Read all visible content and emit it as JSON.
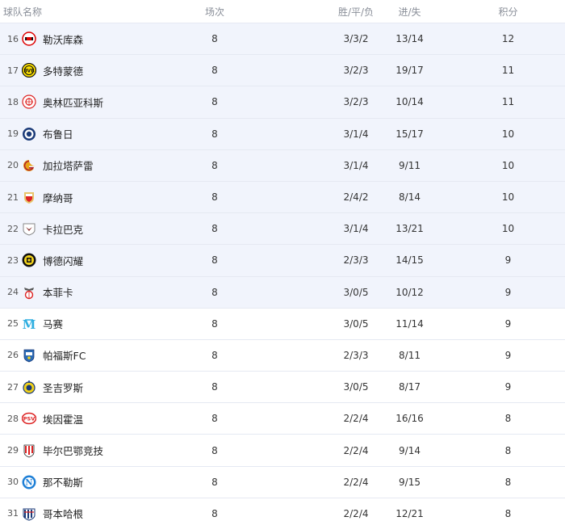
{
  "headers": {
    "team": "球队名称",
    "played": "场次",
    "wdl": "胜/平/负",
    "goals": "进/失",
    "points": "积分"
  },
  "colors": {
    "highlight_row": "#f1f4fc",
    "header_text": "#8a8f99",
    "divider": "#e5e9f2"
  },
  "rows": [
    {
      "rank": "16",
      "team": "勒沃库森",
      "played": "8",
      "wdl": "3/3/2",
      "goals": "13/14",
      "points": "12",
      "icon": "leverkusen-logo-icon",
      "highlight": true
    },
    {
      "rank": "17",
      "team": "多特蒙德",
      "played": "8",
      "wdl": "3/2/3",
      "goals": "19/17",
      "points": "11",
      "icon": "dortmund-logo-icon",
      "highlight": true
    },
    {
      "rank": "18",
      "team": "奥林匹亚科斯",
      "played": "8",
      "wdl": "3/2/3",
      "goals": "10/14",
      "points": "11",
      "icon": "olympiacos-logo-icon",
      "highlight": true
    },
    {
      "rank": "19",
      "team": "布鲁日",
      "played": "8",
      "wdl": "3/1/4",
      "goals": "15/17",
      "points": "10",
      "icon": "brugge-logo-icon",
      "highlight": true
    },
    {
      "rank": "20",
      "team": "加拉塔萨雷",
      "played": "8",
      "wdl": "3/1/4",
      "goals": "9/11",
      "points": "10",
      "icon": "galatasaray-logo-icon",
      "highlight": true
    },
    {
      "rank": "21",
      "team": "摩纳哥",
      "played": "8",
      "wdl": "2/4/2",
      "goals": "8/14",
      "points": "10",
      "icon": "monaco-logo-icon",
      "highlight": true
    },
    {
      "rank": "22",
      "team": "卡拉巴克",
      "played": "8",
      "wdl": "3/1/4",
      "goals": "13/21",
      "points": "10",
      "icon": "qarabag-logo-icon",
      "highlight": true
    },
    {
      "rank": "23",
      "team": "博德闪耀",
      "played": "8",
      "wdl": "2/3/3",
      "goals": "14/15",
      "points": "9",
      "icon": "bodo-glimt-logo-icon",
      "highlight": true
    },
    {
      "rank": "24",
      "team": "本菲卡",
      "played": "8",
      "wdl": "3/0/5",
      "goals": "10/12",
      "points": "9",
      "icon": "benfica-logo-icon",
      "highlight": true
    },
    {
      "rank": "25",
      "team": "马赛",
      "played": "8",
      "wdl": "3/0/5",
      "goals": "11/14",
      "points": "9",
      "icon": "marseille-logo-icon",
      "highlight": false
    },
    {
      "rank": "26",
      "team": "帕福斯FC",
      "played": "8",
      "wdl": "2/3/3",
      "goals": "8/11",
      "points": "9",
      "icon": "pafos-logo-icon",
      "highlight": false
    },
    {
      "rank": "27",
      "team": "圣吉罗斯",
      "played": "8",
      "wdl": "3/0/5",
      "goals": "8/17",
      "points": "9",
      "icon": "union-sg-logo-icon",
      "highlight": false
    },
    {
      "rank": "28",
      "team": "埃因霍温",
      "played": "8",
      "wdl": "2/2/4",
      "goals": "16/16",
      "points": "8",
      "icon": "psv-logo-icon",
      "highlight": false
    },
    {
      "rank": "29",
      "team": "毕尔巴鄂竞技",
      "played": "8",
      "wdl": "2/2/4",
      "goals": "9/14",
      "points": "8",
      "icon": "athletic-bilbao-logo-icon",
      "highlight": false
    },
    {
      "rank": "30",
      "team": "那不勒斯",
      "played": "8",
      "wdl": "2/2/4",
      "goals": "9/15",
      "points": "8",
      "icon": "napoli-logo-icon",
      "highlight": false
    },
    {
      "rank": "31",
      "team": "哥本哈根",
      "played": "8",
      "wdl": "2/2/4",
      "goals": "12/21",
      "points": "8",
      "icon": "copenhagen-logo-icon",
      "highlight": false
    }
  ]
}
